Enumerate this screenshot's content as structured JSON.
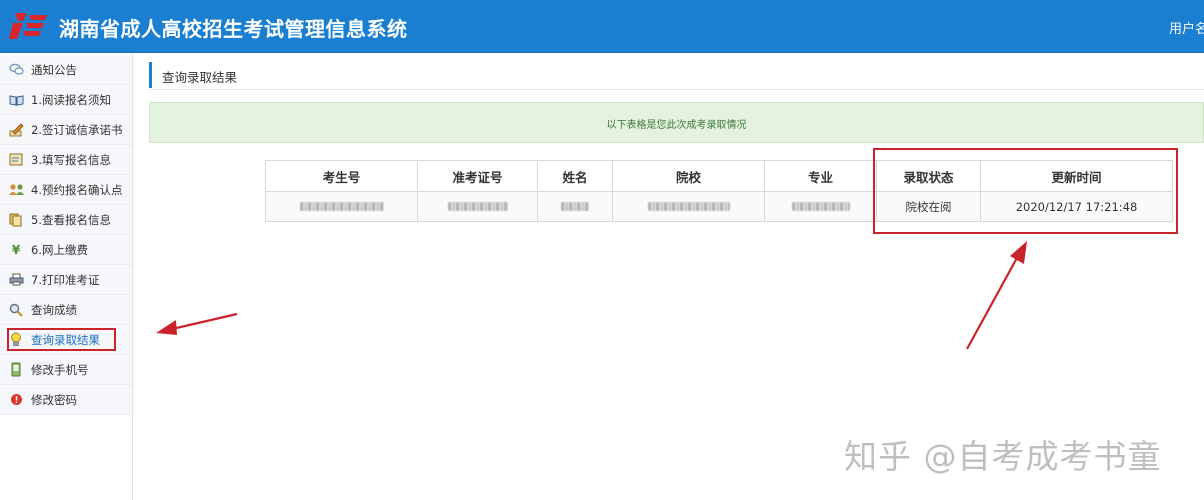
{
  "header": {
    "title": "湖南省成人高校招生考试管理信息系统",
    "user_label": "用户名",
    "brand_color": "#1a7fd0"
  },
  "sidebar": {
    "items": [
      {
        "label": "通知公告",
        "icon": "chat-bubbles-icon"
      },
      {
        "label": "1.阅读报名须知",
        "icon": "book-icon"
      },
      {
        "label": "2.签订诚信承诺书",
        "icon": "pen-sign-icon"
      },
      {
        "label": "3.填写报名信息",
        "icon": "form-edit-icon"
      },
      {
        "label": "4.预约报名确认点",
        "icon": "people-icon"
      },
      {
        "label": "5.查看报名信息",
        "icon": "documents-icon"
      },
      {
        "label": "6.网上缴费",
        "icon": "yen-icon"
      },
      {
        "label": "7.打印准考证",
        "icon": "printer-icon"
      },
      {
        "label": "查询成绩",
        "icon": "magnifier-icon"
      },
      {
        "label": "查询录取结果",
        "icon": "lightbulb-icon",
        "active": true
      },
      {
        "label": "修改手机号",
        "icon": "phone-icon"
      },
      {
        "label": "修改密码",
        "icon": "warning-icon"
      }
    ]
  },
  "panel": {
    "title": "查询录取结果",
    "notice": "以下表格是您此次成考录取情况"
  },
  "table": {
    "headers": [
      "考生号",
      "准考证号",
      "姓名",
      "院校",
      "专业",
      "录取状态",
      "更新时间"
    ],
    "row": {
      "status": "院校在阅",
      "updated": "2020/12/17 17:21:48"
    }
  },
  "watermark": "知乎 @自考成考书童",
  "accent_red": "#c9242b"
}
